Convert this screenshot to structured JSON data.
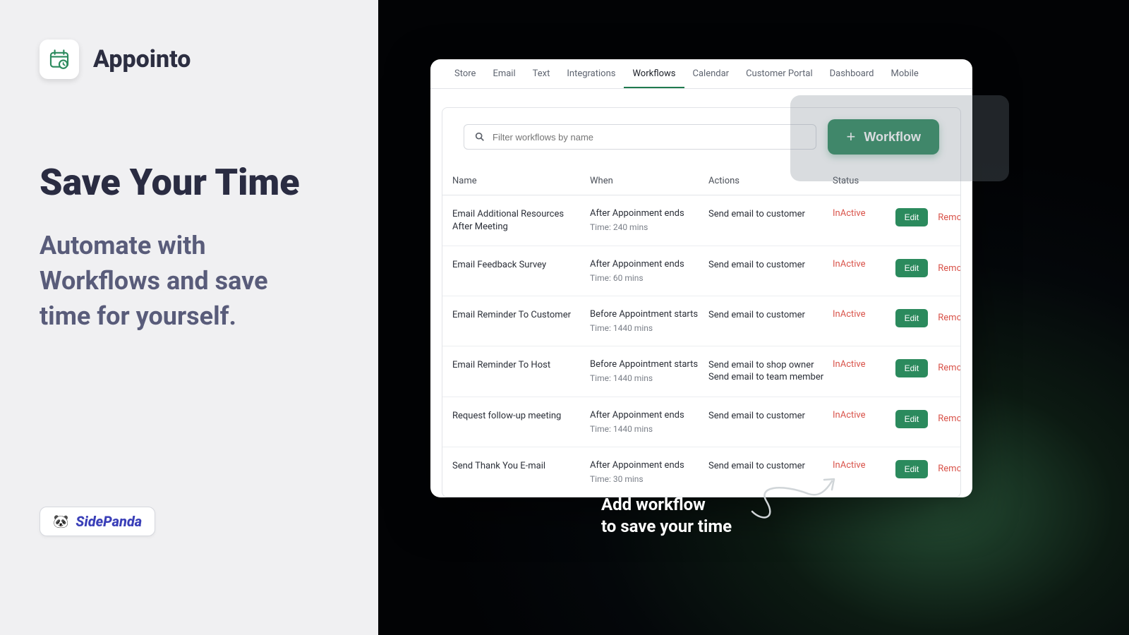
{
  "brand": {
    "name": "Appointo",
    "vendor": "SidePanda"
  },
  "hero": {
    "title": "Save Your Time",
    "subtitle": "Automate with Workflows and save time for yourself."
  },
  "tabs": [
    "Store",
    "Email",
    "Text",
    "Integrations",
    "Workflows",
    "Calendar",
    "Customer Portal",
    "Dashboard",
    "Mobile"
  ],
  "active_tab": "Workflows",
  "search": {
    "placeholder": "Filter workflows by name"
  },
  "add_button": "Workflow",
  "headers": {
    "name": "Name",
    "when": "When",
    "actions": "Actions",
    "status": "Status"
  },
  "labels": {
    "edit": "Edit",
    "remove": "Remove"
  },
  "rows": [
    {
      "name": "Email Additional Resources After Meeting",
      "when": "After Appoinment ends",
      "time": "Time: 240 mins",
      "actions": "Send email to customer",
      "status": "InActive"
    },
    {
      "name": "Email Feedback Survey",
      "when": "After Appoinment ends",
      "time": "Time: 60 mins",
      "actions": "Send email to customer",
      "status": "InActive"
    },
    {
      "name": "Email Reminder To Customer",
      "when": "Before Appointment starts",
      "time": "Time: 1440 mins",
      "actions": "Send email to customer",
      "status": "InActive"
    },
    {
      "name": "Email Reminder To Host",
      "when": "Before Appointment starts",
      "time": "Time: 1440 mins",
      "actions": "Send email to shop owner\nSend email to team member",
      "status": "InActive"
    },
    {
      "name": "Request follow-up meeting",
      "when": "After Appoinment ends",
      "time": "Time: 1440 mins",
      "actions": "Send email to customer",
      "status": "InActive"
    },
    {
      "name": "Send Thank You E-mail",
      "when": "After Appoinment ends",
      "time": "Time: 30 mins",
      "actions": "Send email to customer",
      "status": "InActive"
    }
  ],
  "callout": {
    "line1": "Add workflow",
    "line2": "to save your time"
  }
}
